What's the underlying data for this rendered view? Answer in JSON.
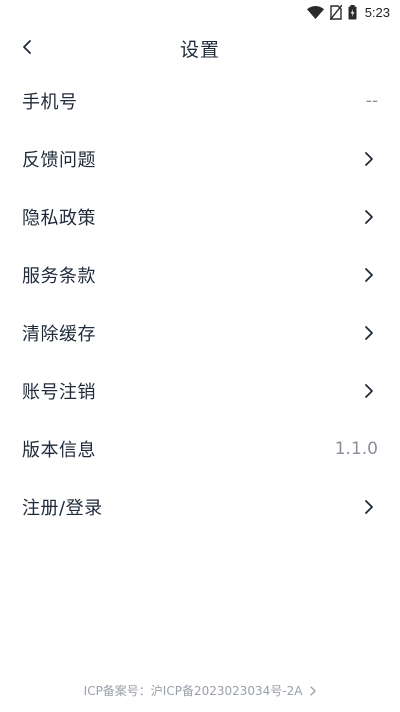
{
  "status_bar": {
    "time": "5:23",
    "icons": [
      "wifi-icon",
      "no-sim-icon",
      "battery-icon"
    ]
  },
  "header": {
    "title": "设置",
    "back_icon": "chevron-left-icon"
  },
  "settings": {
    "items": [
      {
        "label": "手机号",
        "value": "--",
        "has_chevron": false
      },
      {
        "label": "反馈问题",
        "value": "",
        "has_chevron": true
      },
      {
        "label": "隐私政策",
        "value": "",
        "has_chevron": true
      },
      {
        "label": "服务条款",
        "value": "",
        "has_chevron": true
      },
      {
        "label": "清除缓存",
        "value": "",
        "has_chevron": true
      },
      {
        "label": "账号注销",
        "value": "",
        "has_chevron": true
      },
      {
        "label": "版本信息",
        "value": "1.1.0",
        "has_chevron": false
      },
      {
        "label": "注册/登录",
        "value": "",
        "has_chevron": true
      }
    ]
  },
  "footer": {
    "icp": "ICP备案号：沪ICP备2023023034号-2A"
  },
  "colors": {
    "text": "#1f2a3a",
    "value_text": "#8a8f99",
    "footer_text": "#9aa0aa",
    "background": "#ffffff"
  }
}
